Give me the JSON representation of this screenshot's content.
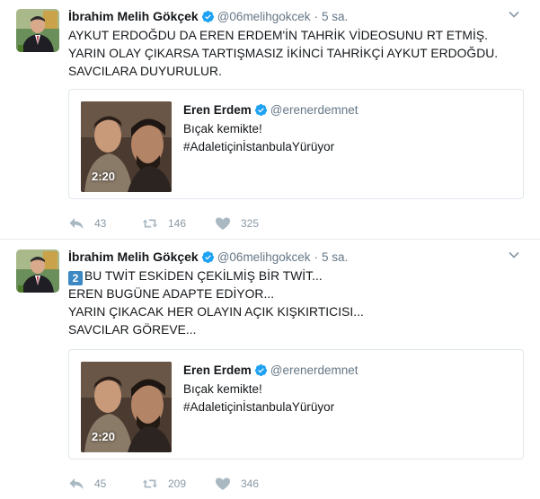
{
  "colors": {
    "text": "#14171a",
    "secondary": "#657786",
    "icon": "#8899a6",
    "verified": "#1da1f2",
    "border": "#e6ecf0"
  },
  "tweets": [
    {
      "author": {
        "name": "İbrahim Melih Gökçek",
        "handle": "@06melihgokcek"
      },
      "time": "5 sa.",
      "dot": "·",
      "lines": [
        "AYKUT ERDOĞDU DA EREN ERDEM'İN TAHRİK VİDEOSUNU RT ETMİŞ.",
        "YARIN OLAY ÇIKARSA TARTIŞMASIZ İKİNCİ TAHRİKÇİ AYKUT ERDOĞDU.",
        "SAVCILARA DUYURULUR."
      ],
      "quote": {
        "name": "Eren Erdem",
        "handle": "@erenerdemnet",
        "lines": [
          "Bıçak kemikte!",
          "#AdaletiçinİstanbulaYürüyor"
        ],
        "duration": "2:20"
      },
      "actions": {
        "reply_icon": "reply-icon",
        "replies": "43",
        "retweet_icon": "retweet-icon",
        "retweets": "146",
        "like_icon": "heart-icon",
        "likes": "325"
      }
    },
    {
      "author": {
        "name": "İbrahim Melih Gökçek",
        "handle": "@06melihgokcek"
      },
      "time": "5 sa.",
      "dot": "·",
      "badge": "2",
      "lines": [
        "BU TWİT ESKİDEN ÇEKİLMİŞ BİR TWİT...",
        "EREN BUGÜNE ADAPTE EDİYOR...",
        "YARIN ÇIKACAK HER OLAYIN AÇIK KIŞKIRTICISI...",
        "SAVCILAR GÖREVE..."
      ],
      "quote": {
        "name": "Eren Erdem",
        "handle": "@erenerdemnet",
        "lines": [
          "Bıçak kemikte!",
          "#AdaletiçinİstanbulaYürüyor"
        ],
        "duration": "2:20"
      },
      "actions": {
        "reply_icon": "reply-icon",
        "replies": "45",
        "retweet_icon": "retweet-icon",
        "retweets": "209",
        "like_icon": "heart-icon",
        "likes": "346"
      }
    }
  ]
}
